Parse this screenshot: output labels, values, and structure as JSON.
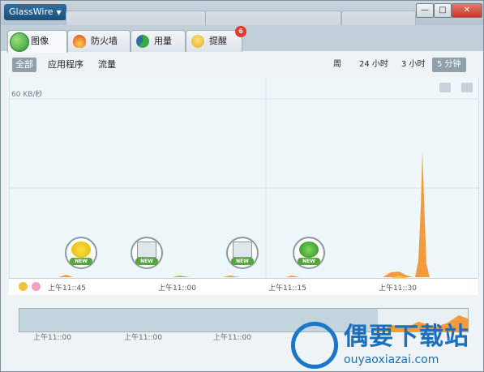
{
  "app": {
    "name": "GlassWire",
    "menu_caret": "▼"
  },
  "window_controls": {
    "minimize": "—",
    "maximize": "□",
    "close": "✕"
  },
  "tabs": [
    {
      "label": "图像",
      "icon": "graph-icon",
      "active": true
    },
    {
      "label": "防火墙",
      "icon": "flame-icon",
      "active": false
    },
    {
      "label": "用量",
      "icon": "usage-pie-icon",
      "active": false
    },
    {
      "label": "提醒",
      "icon": "bulb-icon",
      "active": false,
      "badge": "6"
    }
  ],
  "filters": [
    {
      "label": "全部",
      "active": true
    },
    {
      "label": "应用程序",
      "active": false
    },
    {
      "label": "流量",
      "active": false
    }
  ],
  "time_ranges": [
    {
      "label": "周",
      "active": false
    },
    {
      "label": "24 小时",
      "active": false
    },
    {
      "label": "3 小时",
      "active": false
    },
    {
      "label": "5 分钟",
      "active": true
    }
  ],
  "graph": {
    "scale_label": "60 KB/秒",
    "camera_icon": "camera-icon",
    "pause_icon": "pause-icon"
  },
  "events": [
    {
      "icon": "app-update-icon",
      "tag": "NEW"
    },
    {
      "icon": "window-app-icon",
      "tag": "NEW"
    },
    {
      "icon": "window-app-icon",
      "tag": "NEW"
    },
    {
      "icon": "ie-browser-icon",
      "tag": "NEW"
    }
  ],
  "timeline_ticks": [
    "上午11::45",
    "上午11::00",
    "上午11::15",
    "上午11::30"
  ],
  "overview_ticks": [
    "上午11::00",
    "上午11::00",
    "上午11::00"
  ],
  "watermark": {
    "title": "偶要下载站",
    "url": "ouyaoxiazai.com"
  },
  "colors": {
    "incoming": "#f39a3c",
    "outgoing": "#f2c55a",
    "active_tab_icon": "#3aa845"
  }
}
